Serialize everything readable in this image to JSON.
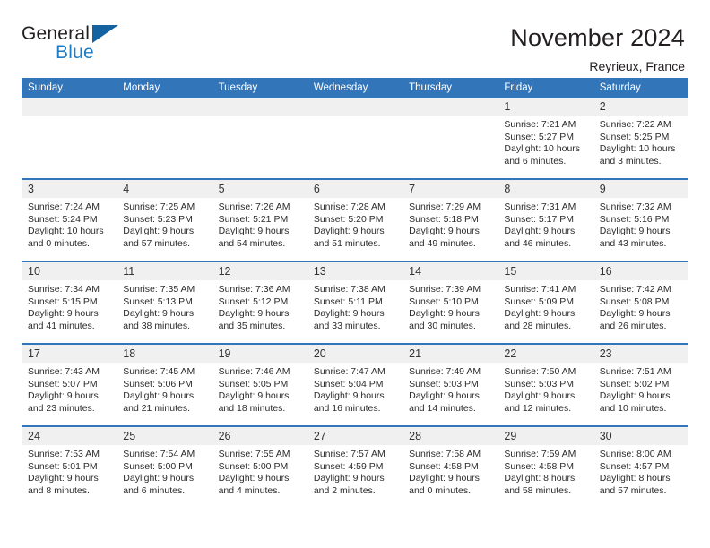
{
  "brand": {
    "name_part1": "General",
    "name_part2": "Blue",
    "triangle_icon": "blue-triangle-icon",
    "accent_color": "#1f7dc4",
    "logo_dark_color": "#231f20"
  },
  "header": {
    "title": "November 2024",
    "subtitle": "Reyrieux, France"
  },
  "theme": {
    "header_blue": "#3275b8",
    "day_band_gray": "#f0f0f0",
    "page_background": "#ffffff"
  },
  "calendar": {
    "weekday_headers": [
      "Sunday",
      "Monday",
      "Tuesday",
      "Wednesday",
      "Thursday",
      "Friday",
      "Saturday"
    ],
    "weeks": [
      [
        {
          "day": "",
          "blank": true,
          "sunrise": "",
          "sunset": "",
          "daylight_line1": "",
          "daylight_line2": ""
        },
        {
          "day": "",
          "blank": true,
          "sunrise": "",
          "sunset": "",
          "daylight_line1": "",
          "daylight_line2": ""
        },
        {
          "day": "",
          "blank": true,
          "sunrise": "",
          "sunset": "",
          "daylight_line1": "",
          "daylight_line2": ""
        },
        {
          "day": "",
          "blank": true,
          "sunrise": "",
          "sunset": "",
          "daylight_line1": "",
          "daylight_line2": ""
        },
        {
          "day": "",
          "blank": true,
          "sunrise": "",
          "sunset": "",
          "daylight_line1": "",
          "daylight_line2": ""
        },
        {
          "day": "1",
          "blank": false,
          "sunrise": "Sunrise: 7:21 AM",
          "sunset": "Sunset: 5:27 PM",
          "daylight_line1": "Daylight: 10 hours",
          "daylight_line2": "and 6 minutes."
        },
        {
          "day": "2",
          "blank": false,
          "sunrise": "Sunrise: 7:22 AM",
          "sunset": "Sunset: 5:25 PM",
          "daylight_line1": "Daylight: 10 hours",
          "daylight_line2": "and 3 minutes."
        }
      ],
      [
        {
          "day": "3",
          "blank": false,
          "sunrise": "Sunrise: 7:24 AM",
          "sunset": "Sunset: 5:24 PM",
          "daylight_line1": "Daylight: 10 hours",
          "daylight_line2": "and 0 minutes."
        },
        {
          "day": "4",
          "blank": false,
          "sunrise": "Sunrise: 7:25 AM",
          "sunset": "Sunset: 5:23 PM",
          "daylight_line1": "Daylight: 9 hours",
          "daylight_line2": "and 57 minutes."
        },
        {
          "day": "5",
          "blank": false,
          "sunrise": "Sunrise: 7:26 AM",
          "sunset": "Sunset: 5:21 PM",
          "daylight_line1": "Daylight: 9 hours",
          "daylight_line2": "and 54 minutes."
        },
        {
          "day": "6",
          "blank": false,
          "sunrise": "Sunrise: 7:28 AM",
          "sunset": "Sunset: 5:20 PM",
          "daylight_line1": "Daylight: 9 hours",
          "daylight_line2": "and 51 minutes."
        },
        {
          "day": "7",
          "blank": false,
          "sunrise": "Sunrise: 7:29 AM",
          "sunset": "Sunset: 5:18 PM",
          "daylight_line1": "Daylight: 9 hours",
          "daylight_line2": "and 49 minutes."
        },
        {
          "day": "8",
          "blank": false,
          "sunrise": "Sunrise: 7:31 AM",
          "sunset": "Sunset: 5:17 PM",
          "daylight_line1": "Daylight: 9 hours",
          "daylight_line2": "and 46 minutes."
        },
        {
          "day": "9",
          "blank": false,
          "sunrise": "Sunrise: 7:32 AM",
          "sunset": "Sunset: 5:16 PM",
          "daylight_line1": "Daylight: 9 hours",
          "daylight_line2": "and 43 minutes."
        }
      ],
      [
        {
          "day": "10",
          "blank": false,
          "sunrise": "Sunrise: 7:34 AM",
          "sunset": "Sunset: 5:15 PM",
          "daylight_line1": "Daylight: 9 hours",
          "daylight_line2": "and 41 minutes."
        },
        {
          "day": "11",
          "blank": false,
          "sunrise": "Sunrise: 7:35 AM",
          "sunset": "Sunset: 5:13 PM",
          "daylight_line1": "Daylight: 9 hours",
          "daylight_line2": "and 38 minutes."
        },
        {
          "day": "12",
          "blank": false,
          "sunrise": "Sunrise: 7:36 AM",
          "sunset": "Sunset: 5:12 PM",
          "daylight_line1": "Daylight: 9 hours",
          "daylight_line2": "and 35 minutes."
        },
        {
          "day": "13",
          "blank": false,
          "sunrise": "Sunrise: 7:38 AM",
          "sunset": "Sunset: 5:11 PM",
          "daylight_line1": "Daylight: 9 hours",
          "daylight_line2": "and 33 minutes."
        },
        {
          "day": "14",
          "blank": false,
          "sunrise": "Sunrise: 7:39 AM",
          "sunset": "Sunset: 5:10 PM",
          "daylight_line1": "Daylight: 9 hours",
          "daylight_line2": "and 30 minutes."
        },
        {
          "day": "15",
          "blank": false,
          "sunrise": "Sunrise: 7:41 AM",
          "sunset": "Sunset: 5:09 PM",
          "daylight_line1": "Daylight: 9 hours",
          "daylight_line2": "and 28 minutes."
        },
        {
          "day": "16",
          "blank": false,
          "sunrise": "Sunrise: 7:42 AM",
          "sunset": "Sunset: 5:08 PM",
          "daylight_line1": "Daylight: 9 hours",
          "daylight_line2": "and 26 minutes."
        }
      ],
      [
        {
          "day": "17",
          "blank": false,
          "sunrise": "Sunrise: 7:43 AM",
          "sunset": "Sunset: 5:07 PM",
          "daylight_line1": "Daylight: 9 hours",
          "daylight_line2": "and 23 minutes."
        },
        {
          "day": "18",
          "blank": false,
          "sunrise": "Sunrise: 7:45 AM",
          "sunset": "Sunset: 5:06 PM",
          "daylight_line1": "Daylight: 9 hours",
          "daylight_line2": "and 21 minutes."
        },
        {
          "day": "19",
          "blank": false,
          "sunrise": "Sunrise: 7:46 AM",
          "sunset": "Sunset: 5:05 PM",
          "daylight_line1": "Daylight: 9 hours",
          "daylight_line2": "and 18 minutes."
        },
        {
          "day": "20",
          "blank": false,
          "sunrise": "Sunrise: 7:47 AM",
          "sunset": "Sunset: 5:04 PM",
          "daylight_line1": "Daylight: 9 hours",
          "daylight_line2": "and 16 minutes."
        },
        {
          "day": "21",
          "blank": false,
          "sunrise": "Sunrise: 7:49 AM",
          "sunset": "Sunset: 5:03 PM",
          "daylight_line1": "Daylight: 9 hours",
          "daylight_line2": "and 14 minutes."
        },
        {
          "day": "22",
          "blank": false,
          "sunrise": "Sunrise: 7:50 AM",
          "sunset": "Sunset: 5:03 PM",
          "daylight_line1": "Daylight: 9 hours",
          "daylight_line2": "and 12 minutes."
        },
        {
          "day": "23",
          "blank": false,
          "sunrise": "Sunrise: 7:51 AM",
          "sunset": "Sunset: 5:02 PM",
          "daylight_line1": "Daylight: 9 hours",
          "daylight_line2": "and 10 minutes."
        }
      ],
      [
        {
          "day": "24",
          "blank": false,
          "sunrise": "Sunrise: 7:53 AM",
          "sunset": "Sunset: 5:01 PM",
          "daylight_line1": "Daylight: 9 hours",
          "daylight_line2": "and 8 minutes."
        },
        {
          "day": "25",
          "blank": false,
          "sunrise": "Sunrise: 7:54 AM",
          "sunset": "Sunset: 5:00 PM",
          "daylight_line1": "Daylight: 9 hours",
          "daylight_line2": "and 6 minutes."
        },
        {
          "day": "26",
          "blank": false,
          "sunrise": "Sunrise: 7:55 AM",
          "sunset": "Sunset: 5:00 PM",
          "daylight_line1": "Daylight: 9 hours",
          "daylight_line2": "and 4 minutes."
        },
        {
          "day": "27",
          "blank": false,
          "sunrise": "Sunrise: 7:57 AM",
          "sunset": "Sunset: 4:59 PM",
          "daylight_line1": "Daylight: 9 hours",
          "daylight_line2": "and 2 minutes."
        },
        {
          "day": "28",
          "blank": false,
          "sunrise": "Sunrise: 7:58 AM",
          "sunset": "Sunset: 4:58 PM",
          "daylight_line1": "Daylight: 9 hours",
          "daylight_line2": "and 0 minutes."
        },
        {
          "day": "29",
          "blank": false,
          "sunrise": "Sunrise: 7:59 AM",
          "sunset": "Sunset: 4:58 PM",
          "daylight_line1": "Daylight: 8 hours",
          "daylight_line2": "and 58 minutes."
        },
        {
          "day": "30",
          "blank": false,
          "sunrise": "Sunrise: 8:00 AM",
          "sunset": "Sunset: 4:57 PM",
          "daylight_line1": "Daylight: 8 hours",
          "daylight_line2": "and 57 minutes."
        }
      ]
    ]
  }
}
